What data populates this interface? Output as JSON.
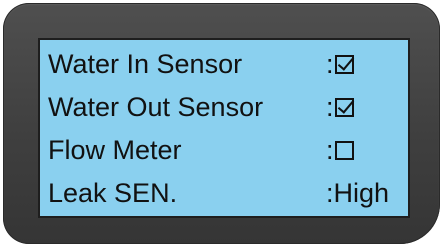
{
  "display": {
    "rows": [
      {
        "label": "Water In Sensor",
        "separator": ":",
        "state": "checked"
      },
      {
        "label": "Water Out Sensor",
        "separator": ":",
        "state": "checked"
      },
      {
        "label": "Flow Meter",
        "separator": ":",
        "state": "unchecked"
      },
      {
        "label": "Leak SEN.",
        "separator": ":",
        "value": "High"
      }
    ]
  },
  "colors": {
    "screen_background": "#8ad0ef",
    "bezel": "#444444",
    "text": "#111111"
  }
}
